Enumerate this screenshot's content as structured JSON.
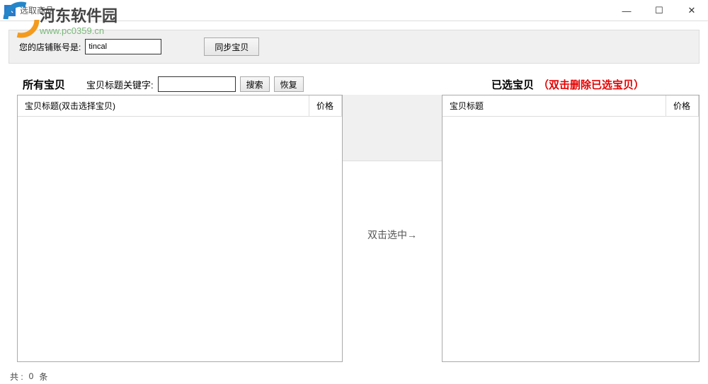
{
  "window": {
    "title": "选取商品",
    "app_icon_text": "fK",
    "controls": {
      "min": "—",
      "max": "☐",
      "close": "✕"
    }
  },
  "watermark": {
    "name": "河东软件园",
    "url": "www.pc0359.cn"
  },
  "top": {
    "account_label": "您的店铺账号是:",
    "account_value": "tincal",
    "sync_btn": "同步宝贝"
  },
  "filter": {
    "all_label": "所有宝贝",
    "keyword_label": "宝贝标题关键字:",
    "keyword_value": "",
    "search_btn": "搜索",
    "reset_btn": "恢复",
    "selected_label": "已选宝贝",
    "selected_hint": "（双击删除已选宝贝）"
  },
  "left_table": {
    "cols": {
      "title": "宝贝标题(双击选择宝贝)",
      "price": "价格"
    },
    "rows": []
  },
  "right_table": {
    "cols": {
      "title": "宝贝标题",
      "price": "价格"
    },
    "rows": []
  },
  "middle_hint": "双击选中→",
  "status": {
    "prefix": "共 :",
    "count": "0",
    "suffix": "条"
  }
}
